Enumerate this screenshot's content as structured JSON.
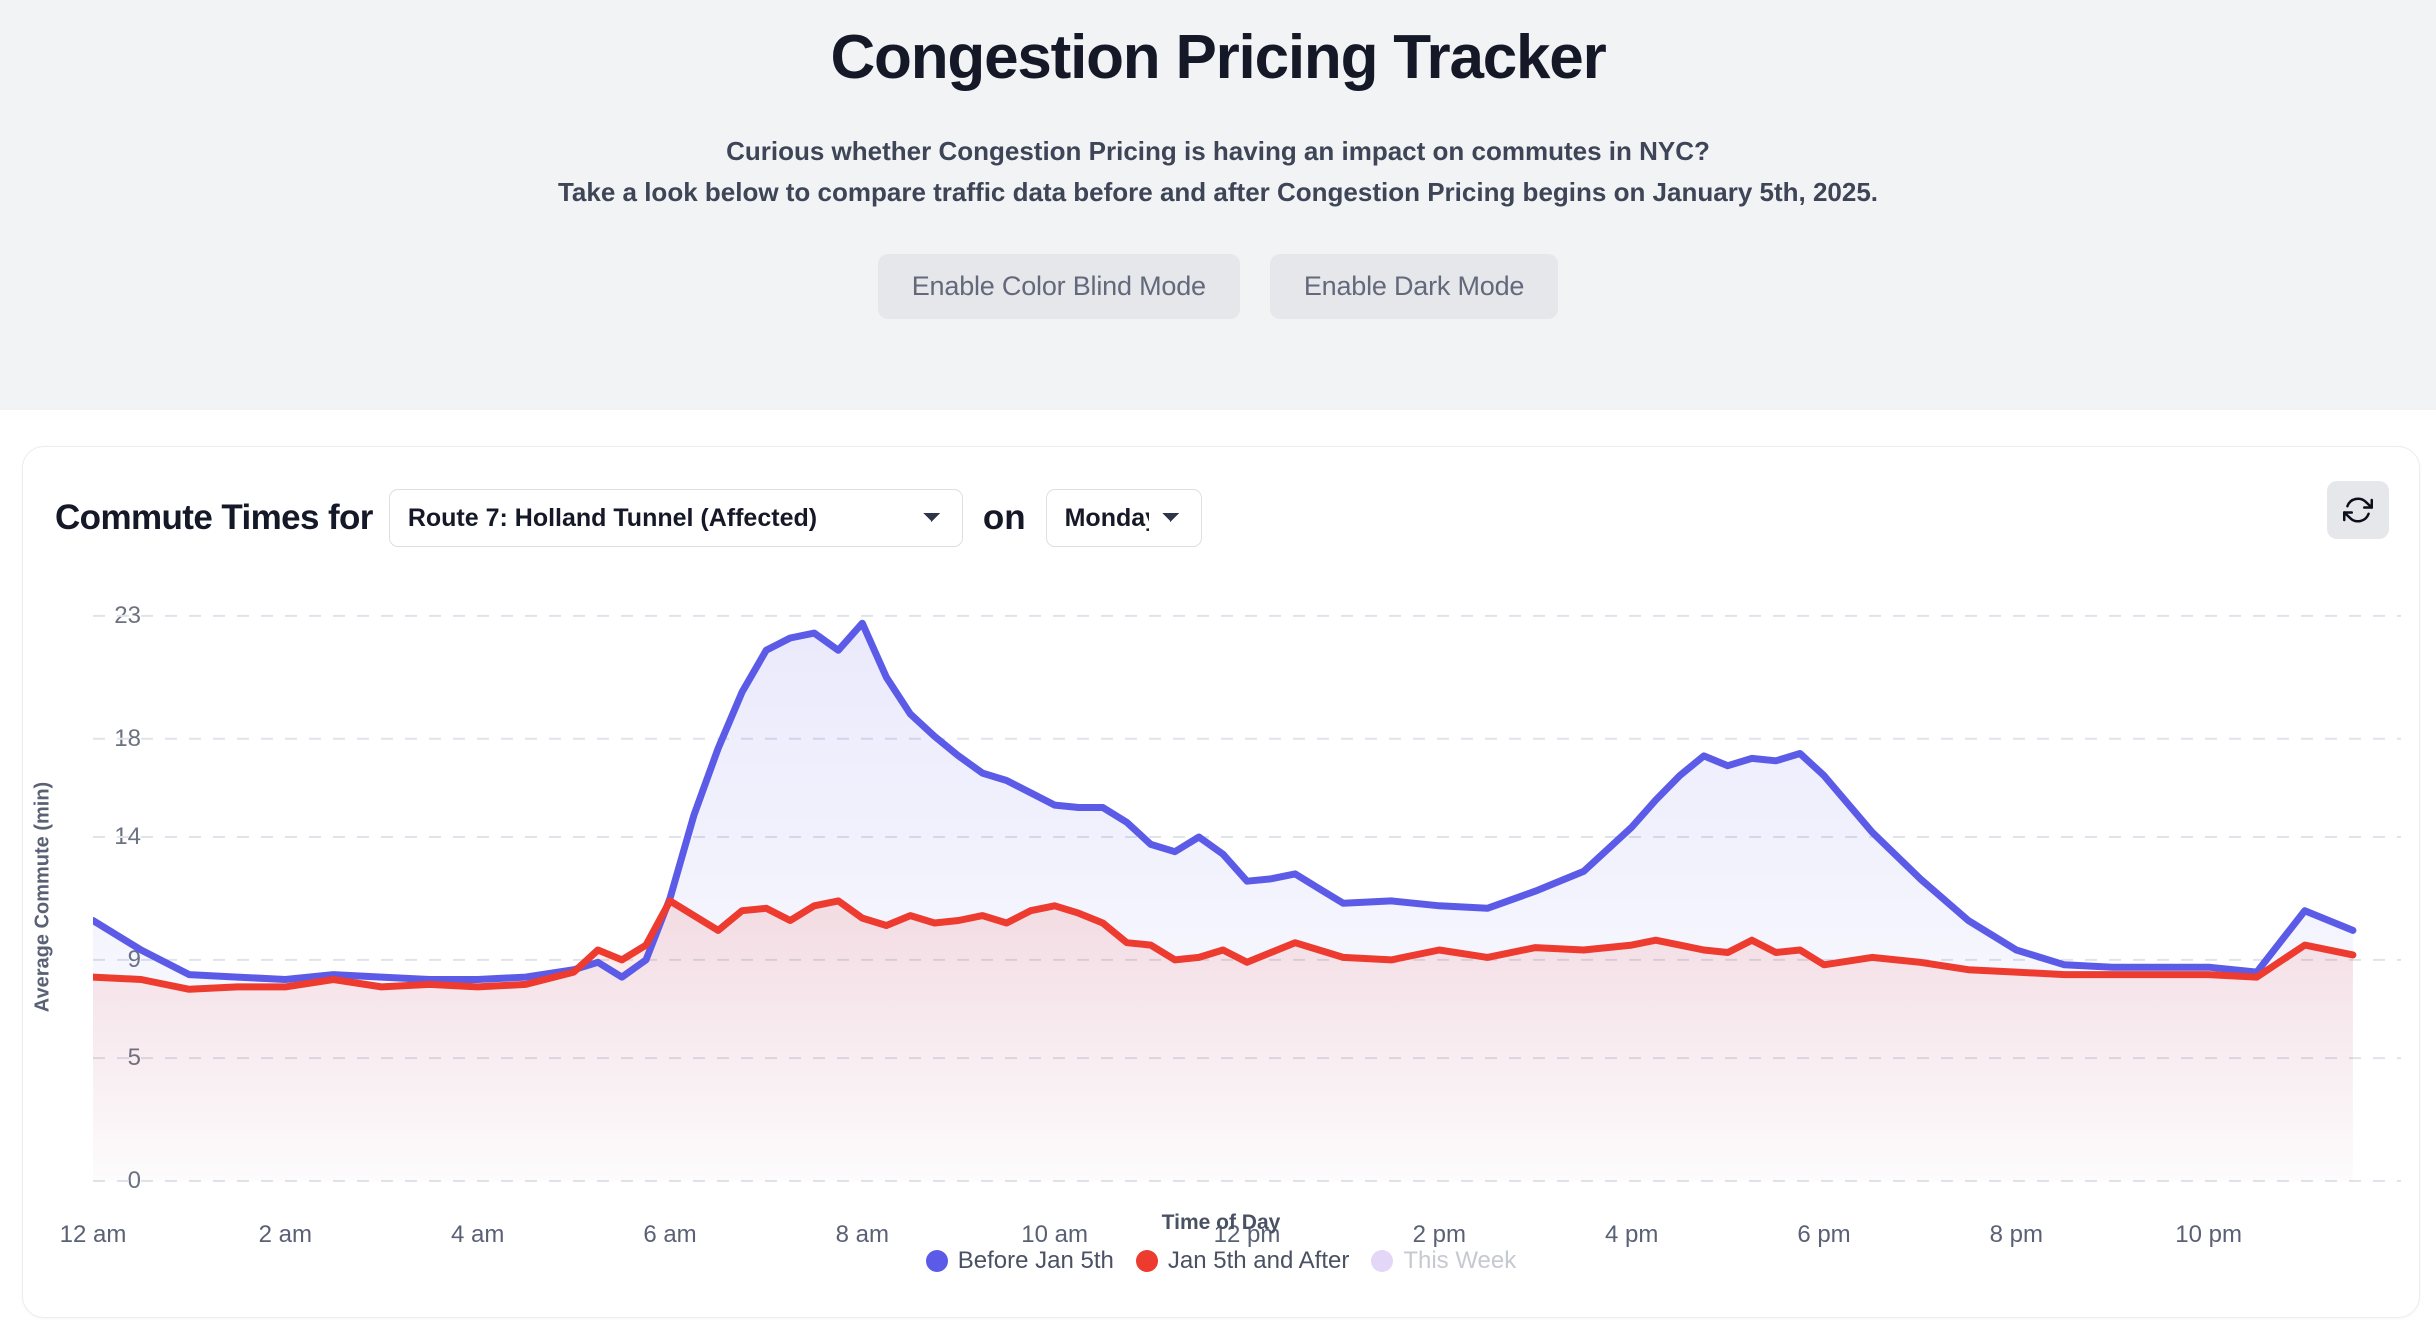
{
  "header": {
    "title": "Congestion Pricing Tracker",
    "subtitle_line1": "Curious whether Congestion Pricing is having an impact on commutes in NYC?",
    "subtitle_line2": "Take a look below to compare traffic data before and after Congestion Pricing begins on January 5th, 2025.",
    "buttons": {
      "color_blind": "Enable Color Blind Mode",
      "dark_mode": "Enable Dark Mode"
    }
  },
  "controls": {
    "label": "Commute Times for",
    "route_selected": "Route 7: Holland Tunnel (Affected)",
    "conjunction": "on",
    "day_selected": "Mondays",
    "refresh_icon": "refresh-icon"
  },
  "colors": {
    "before": "#5b5be8",
    "after": "#ee3b2f",
    "this_week": "#e4d6f7",
    "page_bg": "#ffffff",
    "header_bg": "#f1f3f5",
    "grid": "#dfe3ea",
    "text": "#141827",
    "muted": "#5a6175"
  },
  "chart_data": {
    "type": "line",
    "title": "",
    "xlabel": "Time of Day",
    "ylabel": "Average Commute (min)",
    "ylim": [
      0,
      24.5
    ],
    "yticks": [
      0,
      5,
      9,
      14,
      18,
      23
    ],
    "grid": true,
    "legend_position": "bottom",
    "legend": [
      {
        "name": "Before Jan 5th",
        "color": "#5b5be8",
        "active": true
      },
      {
        "name": "Jan 5th and After",
        "color": "#ee3b2f",
        "active": true
      },
      {
        "name": "This Week",
        "color": "#e4d6f7",
        "active": false
      }
    ],
    "xticks": [
      "12 am",
      "2 am",
      "4 am",
      "6 am",
      "8 am",
      "10 am",
      "12 pm",
      "2 pm",
      "4 pm",
      "6 pm",
      "8 pm",
      "10 pm"
    ],
    "x_hours": [
      0,
      2,
      4,
      6,
      8,
      10,
      12,
      14,
      16,
      18,
      20,
      22
    ],
    "x": [
      0,
      0.5,
      1,
      1.5,
      2,
      2.5,
      3,
      3.5,
      4,
      4.5,
      5,
      5.25,
      5.5,
      5.75,
      6,
      6.25,
      6.5,
      6.75,
      7,
      7.25,
      7.5,
      7.75,
      8,
      8.25,
      8.5,
      8.75,
      9,
      9.25,
      9.5,
      9.75,
      10,
      10.25,
      10.5,
      10.75,
      11,
      11.25,
      11.5,
      11.75,
      12,
      12.25,
      12.5,
      12.75,
      13,
      13.5,
      14,
      14.5,
      15,
      15.5,
      16,
      16.25,
      16.5,
      16.75,
      17,
      17.25,
      17.5,
      17.75,
      18,
      18.5,
      19,
      19.5,
      20,
      20.5,
      21,
      21.5,
      22,
      22.5,
      23,
      23.5
    ],
    "series": [
      {
        "name": "Before Jan 5th",
        "color": "#5b5be8",
        "values": [
          10.6,
          9.4,
          8.4,
          8.3,
          8.2,
          8.4,
          8.3,
          8.2,
          8.2,
          8.3,
          8.6,
          8.9,
          8.3,
          9.0,
          11.5,
          14.9,
          17.6,
          19.9,
          21.6,
          22.1,
          22.3,
          21.6,
          22.7,
          20.5,
          19.0,
          18.1,
          17.3,
          16.6,
          16.3,
          15.8,
          15.3,
          15.2,
          15.2,
          14.6,
          13.7,
          13.4,
          14.0,
          13.3,
          12.2,
          12.3,
          12.5,
          11.9,
          11.3,
          11.4,
          11.2,
          11.1,
          11.8,
          12.6,
          14.4,
          15.5,
          16.5,
          17.3,
          16.9,
          17.2,
          17.1,
          17.4,
          16.5,
          14.2,
          12.3,
          10.6,
          9.4,
          8.8,
          8.7,
          8.7,
          8.7,
          8.5,
          11.0,
          10.2
        ]
      },
      {
        "name": "Jan 5th and After",
        "color": "#ee3b2f",
        "values": [
          8.3,
          8.2,
          7.8,
          7.9,
          7.9,
          8.2,
          7.9,
          8.0,
          7.9,
          8.0,
          8.5,
          9.4,
          9.0,
          9.6,
          11.4,
          10.8,
          10.2,
          11.0,
          11.1,
          10.6,
          11.2,
          11.4,
          10.7,
          10.4,
          10.8,
          10.5,
          10.6,
          10.8,
          10.5,
          11.0,
          11.2,
          10.9,
          10.5,
          9.7,
          9.6,
          9.0,
          9.1,
          9.4,
          8.9,
          9.3,
          9.7,
          9.4,
          9.1,
          9.0,
          9.4,
          9.1,
          9.5,
          9.4,
          9.6,
          9.8,
          9.6,
          9.4,
          9.3,
          9.8,
          9.3,
          9.4,
          8.8,
          9.1,
          8.9,
          8.6,
          8.5,
          8.4,
          8.4,
          8.4,
          8.4,
          8.3,
          9.6,
          9.2
        ]
      }
    ]
  }
}
